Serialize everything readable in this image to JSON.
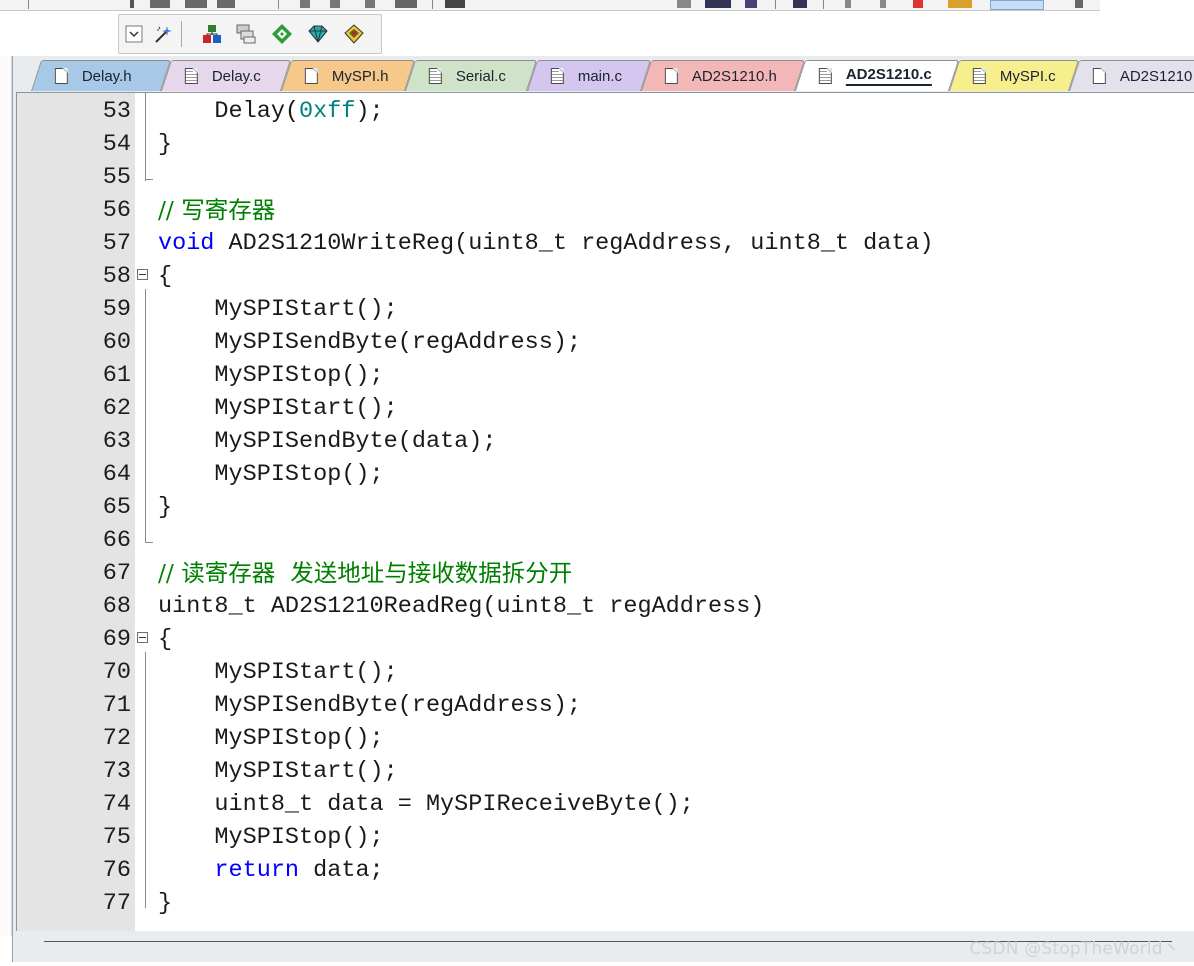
{
  "toolbar": {
    "buttons": [
      "dropdown-arrow-icon",
      "magic-wand-icon",
      "manage-project-items-icon",
      "select-packs-icon",
      "pack-installer-icon",
      "green-diamond-icon",
      "build-target-icon"
    ]
  },
  "tabs": [
    {
      "label": "Delay.h",
      "color": "#a8c8e8",
      "icon": "file"
    },
    {
      "label": "Delay.c",
      "color": "#e6d7ec",
      "icon": "striped"
    },
    {
      "label": "MySPI.h",
      "color": "#f6c88a",
      "icon": "file"
    },
    {
      "label": "Serial.c",
      "color": "#cfe3c9",
      "icon": "striped"
    },
    {
      "label": "main.c",
      "color": "#d4c6ef",
      "icon": "striped"
    },
    {
      "label": "AD2S1210.h",
      "color": "#f3b7b7",
      "icon": "file"
    },
    {
      "label": "AD2S1210.c",
      "color": "#ffffff",
      "icon": "striped",
      "active": true
    },
    {
      "label": "MySPI.c",
      "color": "#f7ef8e",
      "icon": "striped"
    },
    {
      "label": "AD2S1210",
      "color": "#e3e1ec",
      "icon": "file"
    }
  ],
  "code": [
    {
      "n": "53",
      "t": "    Delay(0xff);"
    },
    {
      "n": "54",
      "t": "}"
    },
    {
      "n": "55",
      "t": ""
    },
    {
      "n": "56",
      "t": "// 写寄存器"
    },
    {
      "n": "57",
      "t": "void AD2S1210WriteReg(uint8_t regAddress, uint8_t data)"
    },
    {
      "n": "58",
      "t": "{",
      "fold": true
    },
    {
      "n": "59",
      "t": "    MySPIStart();"
    },
    {
      "n": "60",
      "t": "    MySPISendByte(regAddress);"
    },
    {
      "n": "61",
      "t": "    MySPIStop();"
    },
    {
      "n": "62",
      "t": "    MySPIStart();"
    },
    {
      "n": "63",
      "t": "    MySPISendByte(data);"
    },
    {
      "n": "64",
      "t": "    MySPIStop();"
    },
    {
      "n": "65",
      "t": "}"
    },
    {
      "n": "66",
      "t": ""
    },
    {
      "n": "67",
      "t": "// 读寄存器  发送地址与接收数据拆分开"
    },
    {
      "n": "68",
      "t": "uint8_t AD2S1210ReadReg(uint8_t regAddress)"
    },
    {
      "n": "69",
      "t": "{",
      "fold": true
    },
    {
      "n": "70",
      "t": "    MySPIStart();"
    },
    {
      "n": "71",
      "t": "    MySPISendByte(regAddress);"
    },
    {
      "n": "72",
      "t": "    MySPIStop();"
    },
    {
      "n": "73",
      "t": "    MySPIStart();"
    },
    {
      "n": "74",
      "t": "    uint8_t data = MySPIReceiveByte();"
    },
    {
      "n": "75",
      "t": "    MySPIStop();"
    },
    {
      "n": "76",
      "t": "    return data;"
    },
    {
      "n": "77",
      "t": "}"
    }
  ],
  "watermark": "CSDN @StopTheWorld丶"
}
